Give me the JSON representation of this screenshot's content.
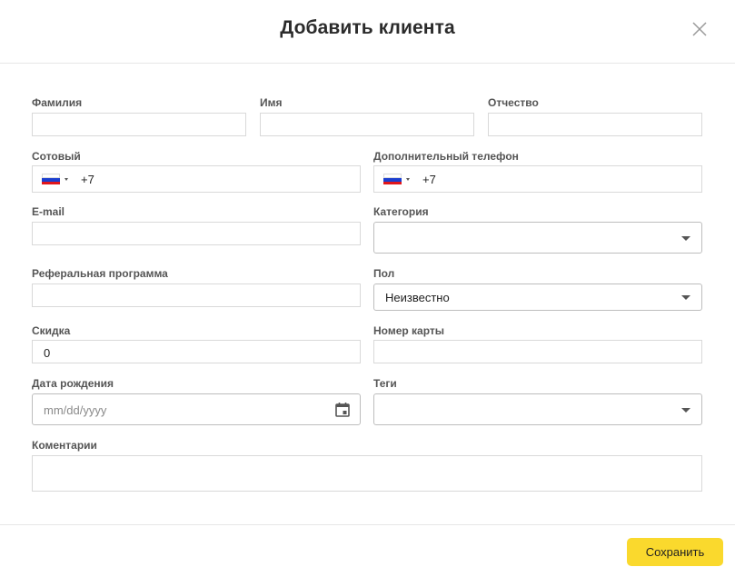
{
  "dialog": {
    "title": "Добавить клиента",
    "close_icon": "close-icon"
  },
  "form": {
    "last_name": {
      "label": "Фамилия",
      "value": ""
    },
    "first_name": {
      "label": "Имя",
      "value": ""
    },
    "patronymic": {
      "label": "Отчество",
      "value": ""
    },
    "mobile": {
      "label": "Сотовый",
      "country_flag": "russia-flag-icon",
      "dial_code": "+7"
    },
    "extra_phone": {
      "label": "Дополнительный телефон",
      "country_flag": "russia-flag-icon",
      "dial_code": "+7"
    },
    "email": {
      "label": "E-mail",
      "value": ""
    },
    "category": {
      "label": "Категория",
      "value": ""
    },
    "referral": {
      "label": "Реферальная программа",
      "value": ""
    },
    "gender": {
      "label": "Пол",
      "value": "Неизвестно"
    },
    "discount": {
      "label": "Скидка",
      "value": "0"
    },
    "card_number": {
      "label": "Номер карты",
      "value": ""
    },
    "birth_date": {
      "label": "Дата рождения",
      "placeholder": "mm/dd/yyyy",
      "icon": "calendar-icon"
    },
    "tags": {
      "label": "Теги",
      "value": ""
    },
    "comments": {
      "label": "Коментарии",
      "value": ""
    }
  },
  "footer": {
    "save_label": "Сохранить"
  },
  "colors": {
    "accent": "#fad92d",
    "border": "#d9d9d9",
    "label": "#555555"
  }
}
